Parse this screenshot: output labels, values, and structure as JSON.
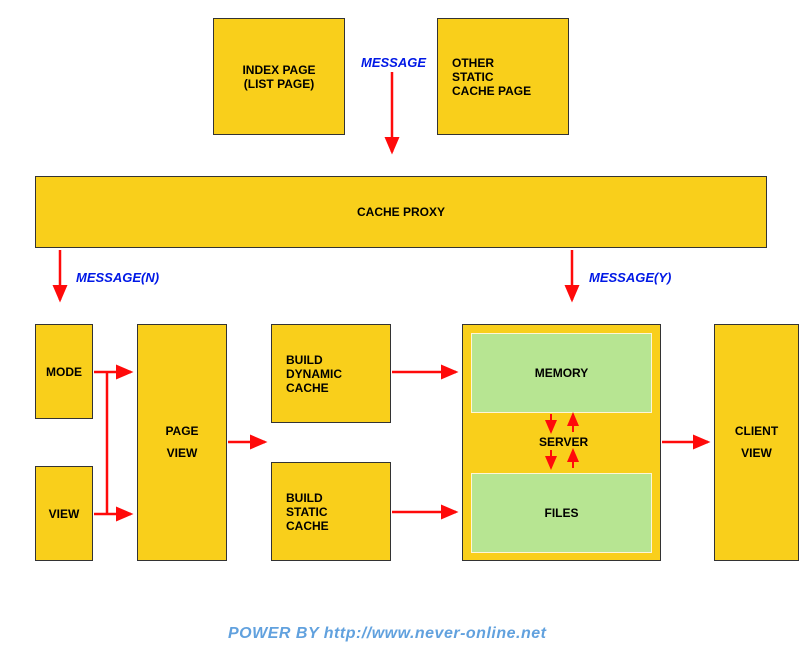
{
  "boxes": {
    "index_page": "INDEX PAGE\n(LIST PAGE)",
    "other_static": "OTHER STATIC CACHE PAGE",
    "cache_proxy": "CACHE PROXY",
    "mode": "MODE",
    "view": "VIEW",
    "page_view": "PAGE VIEW",
    "build_dynamic": "BUILD DYNAMIC CACHE",
    "build_static": "BUILD STATIC CACHE",
    "memory": "MEMORY",
    "server": "SERVER",
    "files": "FILES",
    "client_view": "CLIENT VIEW"
  },
  "labels": {
    "message": "MESSAGE",
    "message_n": "MESSAGE(N)",
    "message_y": "MESSAGE(Y)"
  },
  "footer": "POWER BY http://www.never-online.net",
  "colors": {
    "box_bg": "#f9cf1b",
    "green_bg": "#b7e592",
    "arrow": "#ff0a0a",
    "label": "#0018e6",
    "footer": "#61a1de"
  }
}
